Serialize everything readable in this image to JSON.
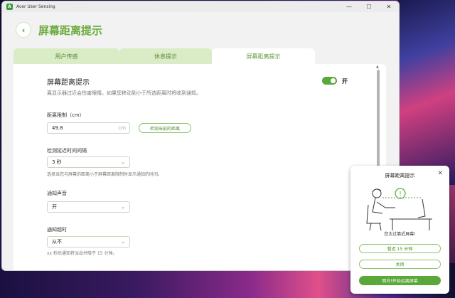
{
  "window": {
    "app_title": "Acer User Sensing",
    "app_icon": "A"
  },
  "controls": {
    "minimize": "—",
    "maximize": "☐",
    "close": "✕"
  },
  "header": {
    "back_icon": "‹",
    "title": "屏幕距离提示"
  },
  "tabs": [
    {
      "label": "用户传感"
    },
    {
      "label": "休息提示"
    },
    {
      "label": "屏幕距离提示"
    }
  ],
  "section": {
    "title": "屏幕距离提示",
    "description": "离显示器过近会伤害眼睛。如果您移动到小于所选距离时将收到通知。",
    "toggle_label": "开"
  },
  "distance": {
    "label": "距离限制（cm）",
    "value": "49.8",
    "unit": "cm",
    "detect_button": "检测当前的距离"
  },
  "interval": {
    "label": "检测延迟时间间隔",
    "value": "3 秒",
    "hint": "选择当您与屏幕的距离小于屏幕距离限制时显示通知的时间。"
  },
  "sound": {
    "label": "通知声音",
    "value": "开"
  },
  "timeout": {
    "label": "通知超时",
    "value": "从不",
    "hint": "xx 秒后通知将淡出并隐于 15 分钟。"
  },
  "popup": {
    "title": "屏幕距离提示",
    "message": "您太过靠近屏幕!",
    "snooze_button": "暂迟 15 分钟",
    "dismiss_button": "关闭",
    "primary_button": "明白!开始远离屏幕",
    "warning_glyph": "!"
  },
  "colors": {
    "accent": "#5aa83a",
    "tab_inactive": "#d9ecc6"
  }
}
